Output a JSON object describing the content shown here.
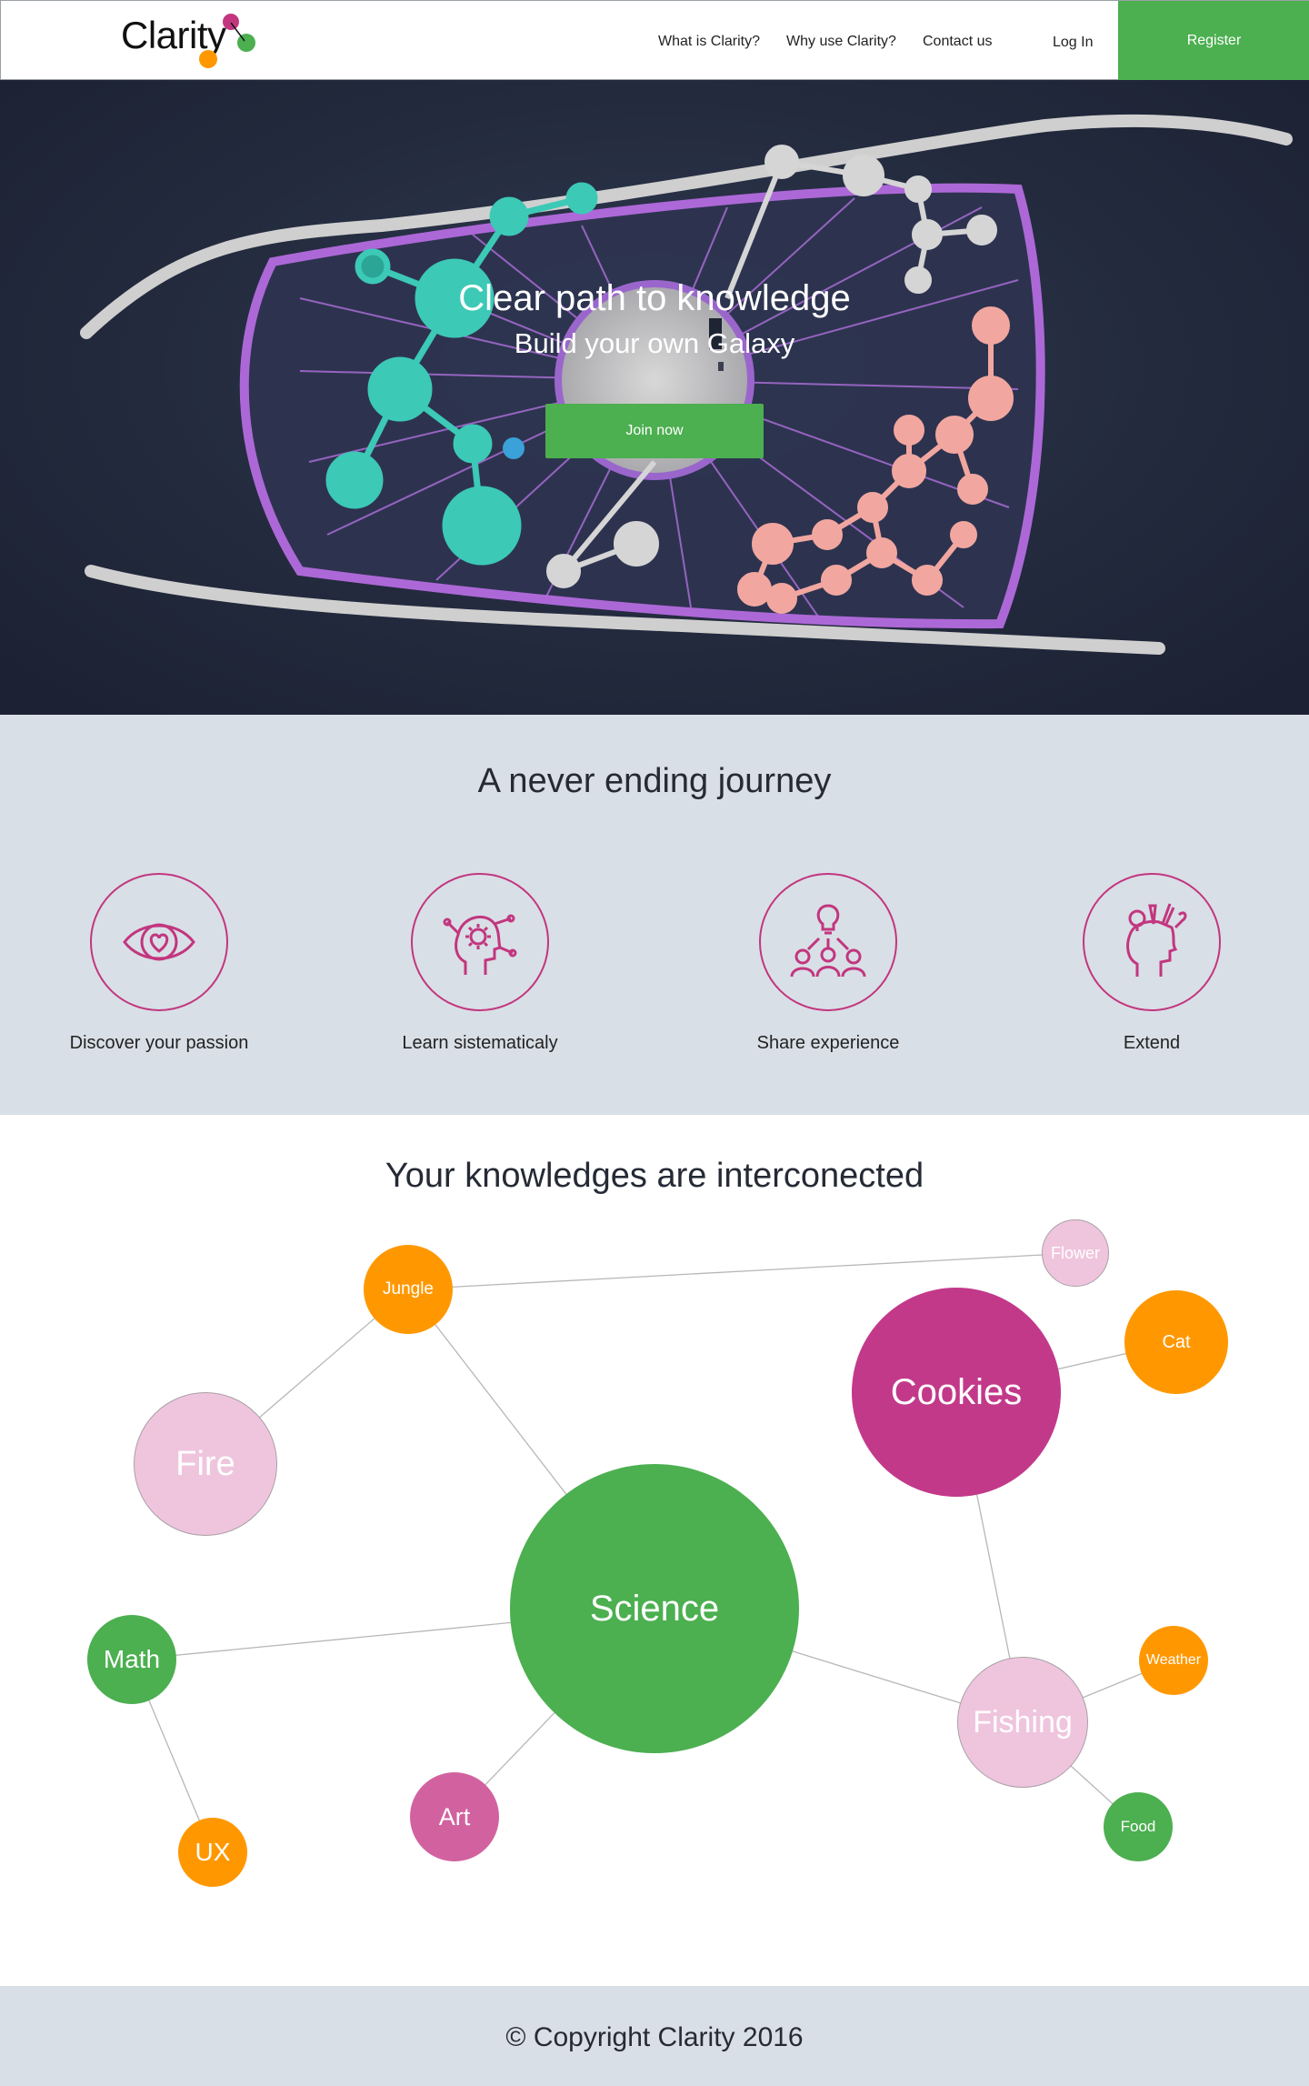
{
  "header": {
    "logo_text": "Clarity",
    "nav": [
      "What is Clarity?",
      "Why use Clarity?",
      "Contact us"
    ],
    "login_label": "Log In",
    "register_label": "Register"
  },
  "hero": {
    "title": "Clear path to knowledge",
    "subtitle": "Build your own Galaxy",
    "cta_label": "Join now"
  },
  "features": {
    "title": "A never ending journey",
    "items": [
      {
        "label": "Discover your passion",
        "icon": "eye-heart-icon"
      },
      {
        "label": "Learn sistematicaly",
        "icon": "head-gear-icon"
      },
      {
        "label": "Share experience",
        "icon": "team-lightbulb-icon"
      },
      {
        "label": "Extend",
        "icon": "head-tools-icon"
      }
    ]
  },
  "graph": {
    "title": "Your knowledges are interconected",
    "nodes": [
      {
        "id": "jungle",
        "label": "Jungle",
        "color": "#ff9800"
      },
      {
        "id": "flower",
        "label": "Flower",
        "color": "#efc5dd"
      },
      {
        "id": "cat",
        "label": "Cat",
        "color": "#ff9800"
      },
      {
        "id": "cookies",
        "label": "Cookies",
        "color": "#c2398a"
      },
      {
        "id": "fire",
        "label": "Fire",
        "color": "#efc5dd"
      },
      {
        "id": "science",
        "label": "Science",
        "color": "#4caf50"
      },
      {
        "id": "math",
        "label": "Math",
        "color": "#4caf50"
      },
      {
        "id": "ux",
        "label": "UX",
        "color": "#ff9800"
      },
      {
        "id": "art",
        "label": "Art",
        "color": "#d2629f"
      },
      {
        "id": "fishing",
        "label": "Fishing",
        "color": "#efc5dd"
      },
      {
        "id": "weather",
        "label": "Weather",
        "color": "#ff9800"
      },
      {
        "id": "food",
        "label": "Food",
        "color": "#4caf50"
      }
    ],
    "edges": [
      [
        "jungle",
        "flower"
      ],
      [
        "jungle",
        "fire"
      ],
      [
        "jungle",
        "science"
      ],
      [
        "cookies",
        "cat"
      ],
      [
        "cookies",
        "fishing"
      ],
      [
        "science",
        "math"
      ],
      [
        "science",
        "art"
      ],
      [
        "science",
        "fishing"
      ],
      [
        "math",
        "ux"
      ],
      [
        "fishing",
        "weather"
      ],
      [
        "fishing",
        "food"
      ]
    ]
  },
  "footer": {
    "copyright": "© Copyright Clarity 2016"
  },
  "colors": {
    "accent_green": "#4caf50",
    "accent_magenta": "#c2367f",
    "section_gray": "#d9dfe6",
    "orange": "#ff9800"
  }
}
